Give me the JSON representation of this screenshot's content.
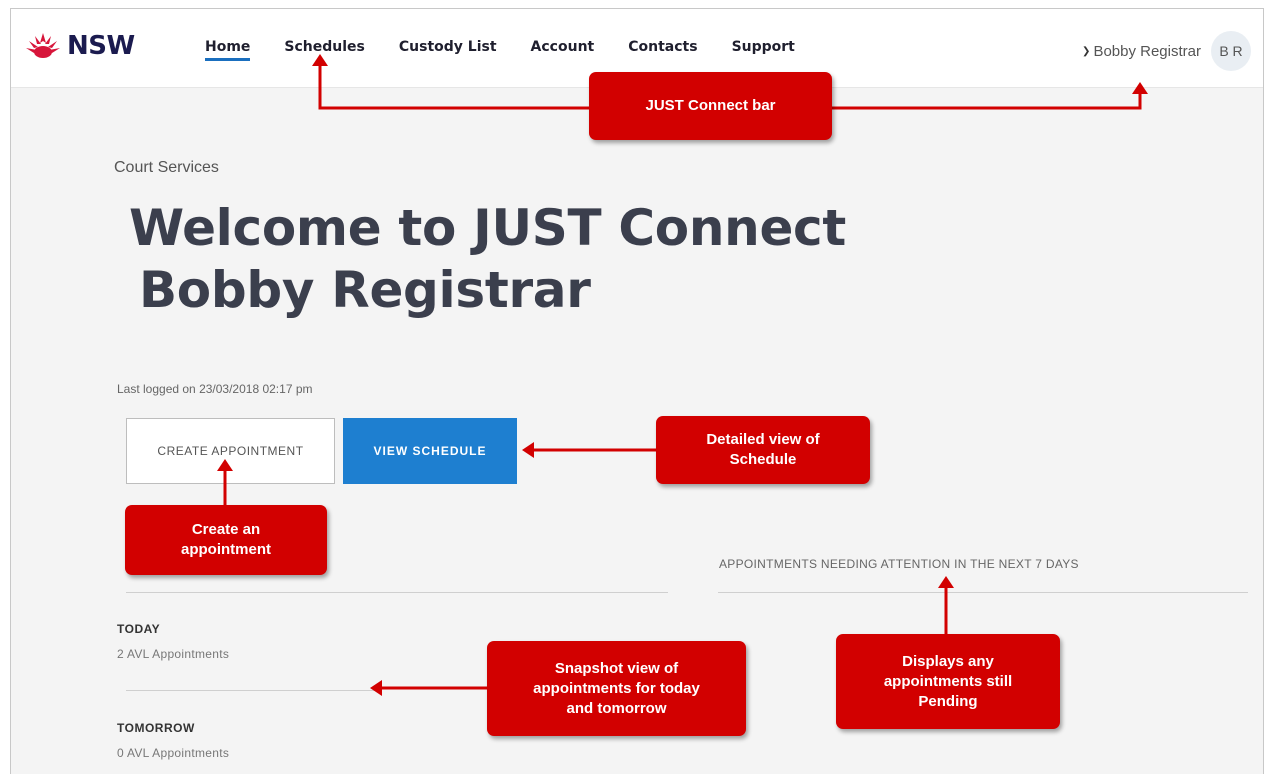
{
  "brand": {
    "logo_text": "NSW"
  },
  "nav": {
    "items": [
      {
        "label": "Home",
        "active": true
      },
      {
        "label": "Schedules",
        "active": false
      },
      {
        "label": "Custody List",
        "active": false
      },
      {
        "label": "Account",
        "active": false
      },
      {
        "label": "Contacts",
        "active": false
      },
      {
        "label": "Support",
        "active": false
      }
    ]
  },
  "user": {
    "name": "Bobby Registrar",
    "initials": "B R"
  },
  "main": {
    "section_label": "Court Services",
    "welcome_line1": "Welcome to JUST Connect",
    "welcome_line2": "Bobby Registrar",
    "last_logged": "Last logged on 23/03/2018 02:17 pm",
    "create_button": "CREATE APPOINTMENT",
    "view_button": "VIEW SCHEDULE",
    "attention_label": "APPOINTMENTS NEEDING ATTENTION IN THE NEXT 7 DAYS",
    "today": {
      "label": "TODAY",
      "count": "2 AVL Appointments"
    },
    "tomorrow": {
      "label": "TOMORROW",
      "count": "0 AVL Appointments"
    }
  },
  "callouts": {
    "bar": "JUST Connect bar",
    "schedule_1": "Detailed view of",
    "schedule_2": "Schedule",
    "create_1": "Create an",
    "create_2": "appointment",
    "snapshot_1": "Snapshot view of",
    "snapshot_2": "appointments for today",
    "snapshot_3": "and tomorrow",
    "pending_1": "Displays any",
    "pending_2": "appointments still",
    "pending_3": "Pending"
  },
  "colors": {
    "callout": "#d20000",
    "primary_button": "#1e7fd0",
    "nav_underline": "#1a6fbf",
    "logo_red": "#d7153a",
    "logo_navy": "#1b1b4f"
  }
}
